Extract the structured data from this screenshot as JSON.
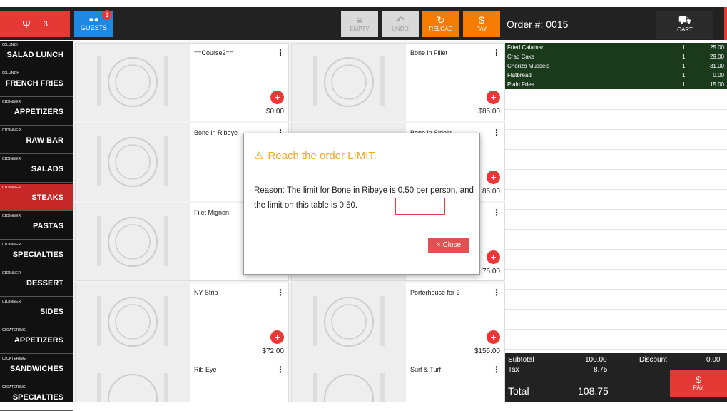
{
  "topbar": {
    "red_icon": "fork-knife-icon",
    "red_count": "3",
    "guests_label": "GUESTS",
    "guests_badge": "1",
    "empty_label": "EMPTY",
    "undo_label": "UNDO",
    "reload_label": "RELOAD",
    "pay_label": "PAY",
    "order_title": "Order #: 0015",
    "cart_label": "CART",
    "colors": {
      "red": "#e53935",
      "blue": "#1e88e5",
      "orange": "#f57c00"
    }
  },
  "sidebar": {
    "items": [
      {
        "small": "00LUNCH",
        "big": "SALAD LUNCH"
      },
      {
        "small": "00LUNCH",
        "big": "FRENCH FRIES"
      },
      {
        "small": "01DINNER",
        "big": "APPETIZERS"
      },
      {
        "small": "01DINNER",
        "big": "RAW BAR"
      },
      {
        "small": "01DINNER",
        "big": "SALADS"
      },
      {
        "small": "01DINNER",
        "big": "STEAKS"
      },
      {
        "small": "01DINNER",
        "big": "PASTAS"
      },
      {
        "small": "01DINNER",
        "big": "SPECIALTIES"
      },
      {
        "small": "01DINNER",
        "big": "DESSERT"
      },
      {
        "small": "01DINNER",
        "big": "SIDES"
      },
      {
        "small": "03CATERING",
        "big": "APPETIZERS"
      },
      {
        "small": "03CATERING",
        "big": "SANDWICHES"
      },
      {
        "small": "03CATERING",
        "big": "SPECIALTIES"
      }
    ]
  },
  "tiles": [
    {
      "name": "==Course2==",
      "price": "$0.00"
    },
    {
      "name": "Bone in Fillet",
      "price": "$85.00"
    },
    {
      "name": "Bone in Ribeye",
      "price": ""
    },
    {
      "name": "Bone in Sirloin",
      "price": "85.00"
    },
    {
      "name": "Filet Mignon",
      "price": ""
    },
    {
      "name": "",
      "price": "75.00"
    },
    {
      "name": "NY Strip",
      "price": "$72.00"
    },
    {
      "name": "Porterhouse for 2",
      "price": "$155.00"
    },
    {
      "name": "Rib Eye",
      "price": ""
    },
    {
      "name": "Surf & Turf",
      "price": ""
    }
  ],
  "dialog": {
    "title": "Reach the order LIMIT.",
    "reason": "Reason: The limit for Bone in Ribeye is 0.50 per person, and the limit on this table is 0.50.",
    "close_label": "× Close"
  },
  "order": {
    "lines": [
      {
        "name": "Fried Calamari",
        "qty": "1",
        "price": "25.00"
      },
      {
        "name": "Crab Cake",
        "qty": "1",
        "price": "29.00"
      },
      {
        "name": "Chorizo Mussels",
        "qty": "1",
        "price": "31.00"
      },
      {
        "name": "Flatbread",
        "qty": "1",
        "price": "0.00"
      },
      {
        "name": "Plain Fries",
        "qty": "1",
        "price": "15.00"
      }
    ],
    "subtotal_label": "Subtotal",
    "subtotal": "100.00",
    "discount_label": "Discount",
    "discount": "0.00",
    "tax_label": "Tax",
    "tax": "8.75",
    "total_label": "Total",
    "total": "108.75",
    "pay_label": "PAY"
  }
}
